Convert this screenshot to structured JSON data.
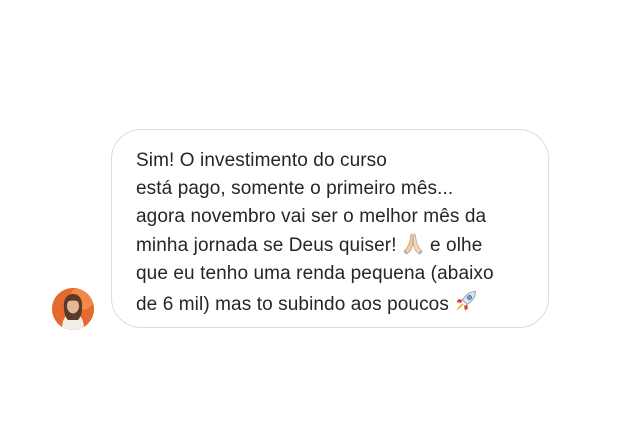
{
  "conversation": {
    "message": {
      "line_1": "Sim! O investimento do curso",
      "line_2": " está pago, somente o primeiro mês...",
      "line_3": "agora novembro vai ser o melhor mês da",
      "line_4a": "minha jornada se Deus quiser!",
      "line_4b": " e olhe",
      "line_5": "que eu tenho uma renda pequena (abaixo",
      "line_6": "de 6 mil) mas to subindo aos poucos",
      "emoji_1": "folded-hands-icon",
      "emoji_2": "rocket-icon"
    },
    "sender_avatar": "avatar-woman",
    "colors": {
      "text": "#262626",
      "bubble_border": "#dcdcdc",
      "avatar_bg": "#e46a2f"
    }
  }
}
